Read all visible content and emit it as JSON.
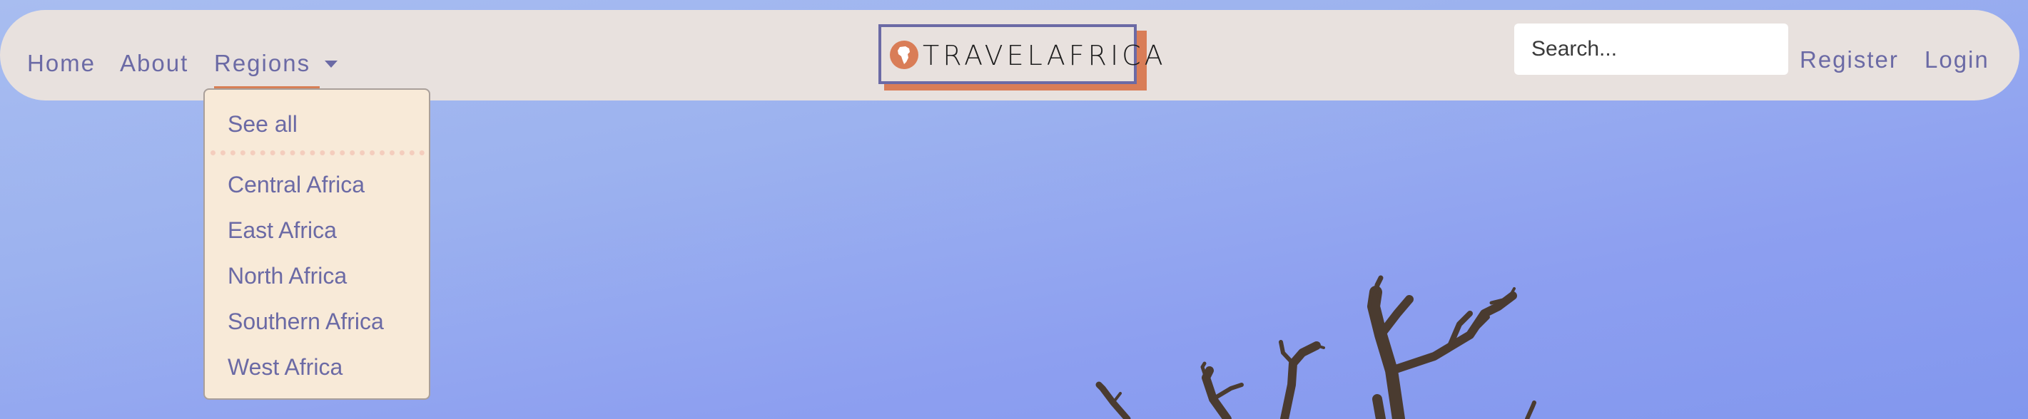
{
  "nav": {
    "home": "Home",
    "about": "About",
    "regions": "Regions",
    "register": "Register",
    "login": "Login"
  },
  "logo": {
    "text": "TRAVELAFRICA",
    "icon": "africa-globe-icon"
  },
  "search": {
    "placeholder": "Search..."
  },
  "dropdown": {
    "see_all": "See all",
    "items": [
      "Central Africa",
      "East Africa",
      "North Africa",
      "Southern Africa",
      "West Africa"
    ]
  },
  "colors": {
    "navbar_bg": "#e8e1de",
    "link": "#6b6aa5",
    "accent": "#d97d57",
    "dropdown_bg": "#f8ead8",
    "sky": "#9cb2ef"
  }
}
